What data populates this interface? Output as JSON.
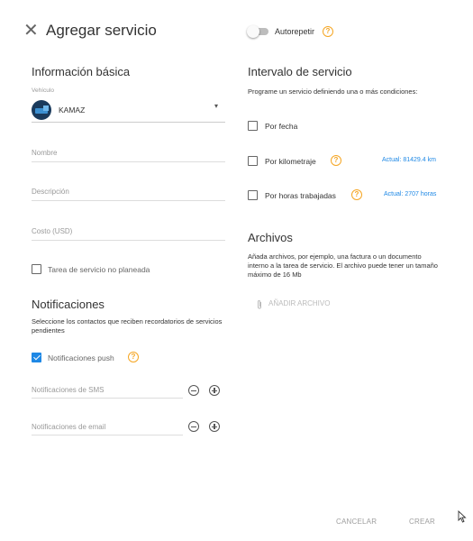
{
  "header": {
    "title": "Agregar servicio",
    "autorepeat_label": "Autorepetir"
  },
  "basic": {
    "title": "Información básica",
    "vehicle_label": "Vehículo",
    "vehicle_value": "KAMAZ",
    "name_placeholder": "Nombre",
    "description_placeholder": "Descripción",
    "cost_placeholder": "Costo (USD)",
    "unplanned_label": "Tarea de servicio no planeada"
  },
  "notifications": {
    "title": "Notificaciones",
    "description": "Seleccione los contactos que reciben recordatorios de servicios pendientes",
    "push_label": "Notificaciones push",
    "push_checked": true,
    "sms_placeholder": "Notificaciones de SMS",
    "email_placeholder": "Notificaciones de email"
  },
  "interval": {
    "title": "Intervalo de servicio",
    "description": "Programe un servicio definiendo una o más condiciones:",
    "by_date": "Por fecha",
    "by_mileage": "Por kilometraje",
    "mileage_current": "Actual: 81429.4 km",
    "by_hours": "Por horas trabajadas",
    "hours_current": "Actual: 2707 horas"
  },
  "files": {
    "title": "Archivos",
    "description": "Añada archivos, por ejemplo, una factura o un documento interno a la tarea de servicio. El archivo puede tener un tamaño máximo de 16 Mb",
    "add_label": "AÑADIR ARCHIVO"
  },
  "footer": {
    "cancel": "CANCELAR",
    "create": "CREAR"
  },
  "colors": {
    "accent": "#1e88e5",
    "help": "#f5a623"
  },
  "icons": {
    "close": "close-icon",
    "help": "help-circle-icon",
    "attach": "paperclip-icon",
    "dropdown": "caret-down-icon",
    "cursor": "mouse-pointer-icon"
  }
}
